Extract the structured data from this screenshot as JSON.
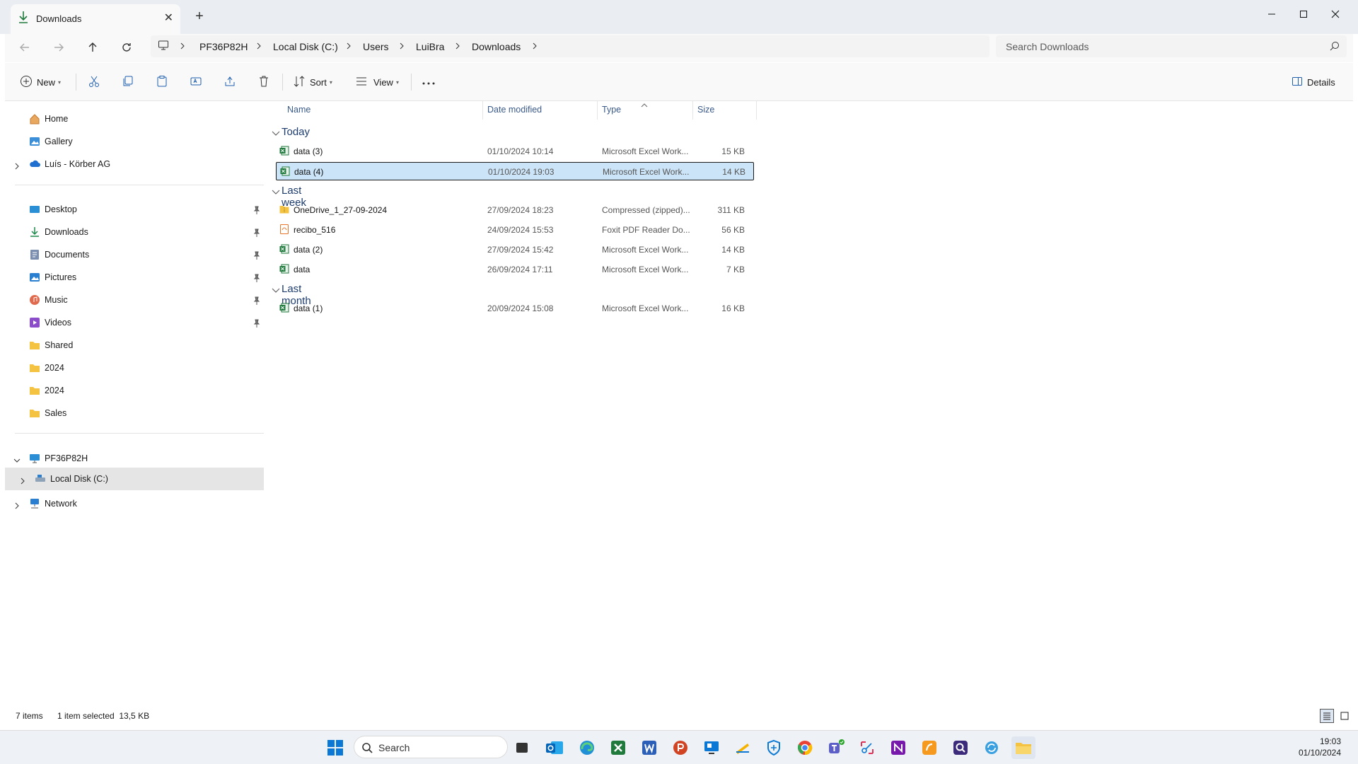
{
  "tab": {
    "title": "Downloads",
    "close": "✕",
    "new": "+"
  },
  "address": {
    "crumbs": [
      "PF36P82H",
      "Local Disk (C:)",
      "Users",
      "LuiBra",
      "Downloads"
    ]
  },
  "search": {
    "placeholder": "Search Downloads"
  },
  "toolbar": {
    "new": "New",
    "sort": "Sort",
    "view": "View",
    "details": "Details"
  },
  "sidebar": {
    "home": "Home",
    "gallery": "Gallery",
    "onedrive": "Luís - Körber AG",
    "desktop": "Desktop",
    "downloads": "Downloads",
    "documents": "Documents",
    "pictures": "Pictures",
    "music": "Music",
    "videos": "Videos",
    "shared": "Shared",
    "f2024a": "2024",
    "f2024b": "2024",
    "sales": "Sales",
    "pc": "PF36P82H",
    "localdisk": "Local Disk (C:)",
    "network": "Network"
  },
  "columns": {
    "name": "Name",
    "date": "Date modified",
    "type": "Type",
    "size": "Size"
  },
  "groups": {
    "today": {
      "label": "Today",
      "rows": [
        {
          "name": "data (3)",
          "date": "01/10/2024 10:14",
          "type": "Microsoft Excel Work...",
          "size": "15 KB"
        },
        {
          "name": "data (4)",
          "date": "01/10/2024 19:03",
          "type": "Microsoft Excel Work...",
          "size": "14 KB"
        }
      ]
    },
    "lastweek": {
      "label": "Last week",
      "rows": [
        {
          "name": "OneDrive_1_27-09-2024",
          "date": "27/09/2024 18:23",
          "type": "Compressed (zipped)...",
          "size": "311 KB"
        },
        {
          "name": "recibo_516",
          "date": "24/09/2024 15:53",
          "type": "Foxit PDF Reader Do...",
          "size": "56 KB"
        },
        {
          "name": "data (2)",
          "date": "27/09/2024 15:42",
          "type": "Microsoft Excel Work...",
          "size": "14 KB"
        },
        {
          "name": "data",
          "date": "26/09/2024 17:11",
          "type": "Microsoft Excel Work...",
          "size": "7 KB"
        }
      ]
    },
    "lastmonth": {
      "label": "Last month",
      "rows": [
        {
          "name": "data (1)",
          "date": "20/09/2024 15:08",
          "type": "Microsoft Excel Work...",
          "size": "16 KB"
        }
      ]
    }
  },
  "status": {
    "items": "7 items",
    "selected": "1 item selected  13,5 KB"
  },
  "taskbar": {
    "search": "Search",
    "time": "19:03",
    "date": "01/10/2024"
  }
}
